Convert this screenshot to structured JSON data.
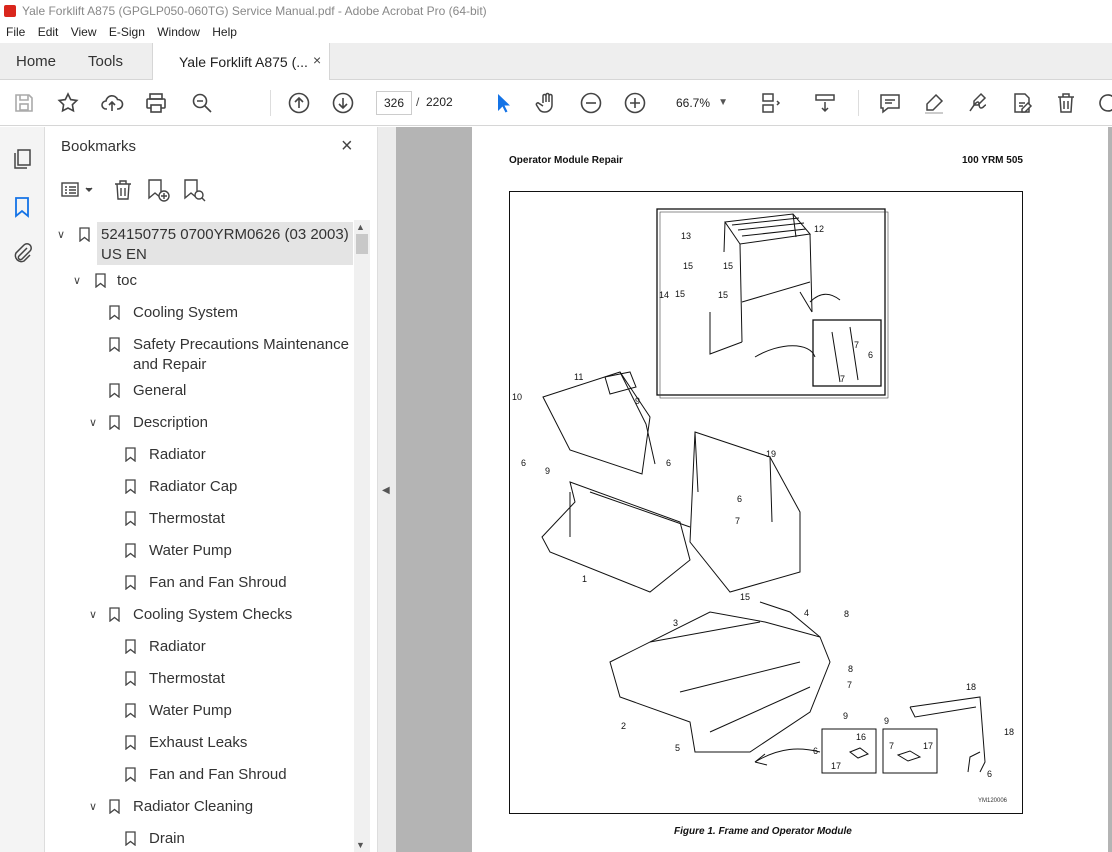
{
  "window": {
    "title": "Yale Forklift A875 (GPGLP050-060TG) Service Manual.pdf - Adobe Acrobat Pro (64-bit)"
  },
  "menu": [
    "File",
    "Edit",
    "View",
    "E-Sign",
    "Window",
    "Help"
  ],
  "tabs": {
    "home": "Home",
    "tools": "Tools",
    "document": "Yale Forklift A875 (...",
    "close": "×"
  },
  "toolbar": {
    "current_page": "326",
    "page_separator": "/",
    "total_pages": "2202",
    "zoom": "66.7%"
  },
  "bookmarks": {
    "title": "Bookmarks",
    "close": "×",
    "items": [
      {
        "label": "524150775 0700YRM0626 (03 2003) US EN",
        "level": 0,
        "expanded": true
      },
      {
        "label": "toc",
        "level": 1,
        "expanded": true
      },
      {
        "label": "Cooling System",
        "level": 2
      },
      {
        "label": "Safety Precautions Maintenance and Repair",
        "level": 2
      },
      {
        "label": "General",
        "level": 2
      },
      {
        "label": "Description",
        "level": 2,
        "expanded": true
      },
      {
        "label": "Radiator",
        "level": 3
      },
      {
        "label": "Radiator Cap",
        "level": 3
      },
      {
        "label": "Thermostat",
        "level": 3
      },
      {
        "label": "Water Pump",
        "level": 3
      },
      {
        "label": "Fan and Fan Shroud",
        "level": 3
      },
      {
        "label": "Cooling System Checks",
        "level": 2,
        "expanded": true
      },
      {
        "label": "Radiator",
        "level": 3
      },
      {
        "label": "Thermostat",
        "level": 3
      },
      {
        "label": "Water Pump",
        "level": 3
      },
      {
        "label": "Exhaust Leaks",
        "level": 3
      },
      {
        "label": "Fan and Fan Shroud",
        "level": 3
      },
      {
        "label": "Radiator Cleaning",
        "level": 2,
        "expanded": true
      },
      {
        "label": "Drain",
        "level": 3
      }
    ]
  },
  "document": {
    "header_left": "Operator Module Repair",
    "header_right": "100 YRM 505",
    "figure_caption": "Figure 1.  Frame and Operator Module",
    "figure_code": "YM120006",
    "callouts": [
      "1",
      "2",
      "3",
      "4",
      "5",
      "6",
      "7",
      "8",
      "9",
      "10",
      "11",
      "12",
      "13",
      "14",
      "15",
      "16",
      "17",
      "18",
      "19"
    ]
  },
  "colors": {
    "accent_blue": "#1473e6",
    "pdf_red": "#d9261c",
    "viewer_gray": "#b4b4b4"
  }
}
